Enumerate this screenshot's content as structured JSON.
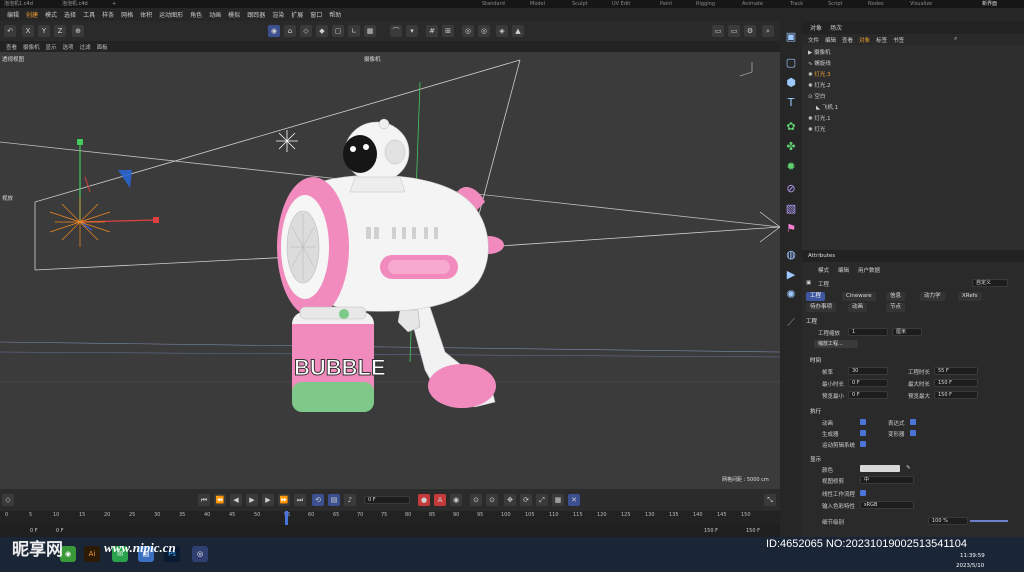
{
  "titlebar": {
    "tabs": [
      "Standard",
      "Model",
      "Sculpt",
      "UV Edit",
      "Paint",
      "Rigging",
      "Animate",
      "Track",
      "Script",
      "Nodes",
      "Visualize"
    ],
    "left_tabs": [
      "泡泡机1.c4d",
      "泡泡机.c4d",
      "+"
    ],
    "new_layout": "新界面"
  },
  "menubar": {
    "items": [
      "编辑",
      "创建",
      "模式",
      "选择",
      "工具",
      "样条",
      "网格",
      "体积",
      "运动图形",
      "角色",
      "动画",
      "模拟",
      "跟踪器",
      "渲染",
      "扩展",
      "窗口",
      "帮助"
    ],
    "active_index": 1
  },
  "toolbar": {
    "axis_labels": [
      "X",
      "Y",
      "Z"
    ]
  },
  "viewport_menu": {
    "items": [
      "查看",
      "摄像机",
      "显示",
      "选项",
      "过滤",
      "面板"
    ]
  },
  "viewport": {
    "label": "透视视图",
    "camera": "摄像机",
    "grid_info": "网格间距 : 5000 cm",
    "side_label": "视放",
    "jar_text": "BUBBLE"
  },
  "timeline": {
    "frame_current": "0 F",
    "ticks": [
      "0",
      "5",
      "10",
      "15",
      "20",
      "25",
      "30",
      "35",
      "40",
      "45",
      "50",
      "55",
      "60",
      "65",
      "70",
      "75",
      "80",
      "85",
      "90",
      "95",
      "100",
      "105",
      "110",
      "115",
      "120",
      "125",
      "130",
      "135",
      "140",
      "145",
      "150"
    ],
    "range_start": "0 F",
    "range_start2": "0 F",
    "range_end": "150 F",
    "range_end2": "150 F"
  },
  "objects_panel": {
    "tabs": [
      "对象",
      "场次"
    ],
    "menu": [
      "文件",
      "编辑",
      "查看",
      "对象",
      "标签",
      "书签"
    ],
    "items": [
      {
        "name": "摄像机",
        "color": "#dddddd"
      },
      {
        "name": "螺旋线",
        "color": "#dddddd"
      },
      {
        "name": "灯光.3",
        "color": "#f0a030"
      },
      {
        "name": "灯光.2",
        "color": "#dddddd"
      },
      {
        "name": "空白",
        "color": "#dddddd"
      },
      {
        "name": "飞机.1",
        "color": "#dddddd"
      },
      {
        "name": "灯光.1",
        "color": "#dddddd"
      },
      {
        "name": "灯光",
        "color": "#dddddd"
      }
    ]
  },
  "attributes": {
    "title": "Attributes",
    "menu": [
      "模式",
      "编辑",
      "用户数据"
    ],
    "object": "工程",
    "preset": "自定义",
    "tabs_row1": [
      "工程",
      "Cineware",
      "信息",
      "动力学",
      "XRefs"
    ],
    "tabs_row2": [
      "待办事项",
      "动画",
      "节点"
    ],
    "section_project": "工程",
    "scale_label": "工程缩放",
    "scale_value": "1",
    "scale_unit": "厘米",
    "scale_button": "缩放工程...",
    "section_time": "时间",
    "fps_label": "帧率",
    "fps_value": "30",
    "duration_label": "工程时长",
    "duration_value": "55 F",
    "min_time_label": "最小时长",
    "min_time_value": "0 F",
    "max_time_label": "最大时长",
    "max_time_value": "150 F",
    "preview_min_label": "预览最小",
    "preview_min_value": "0 F",
    "preview_max_label": "预览最大",
    "preview_max_value": "150 F",
    "section_exec": "执行",
    "exec_items": [
      "动画",
      "生成器",
      "运动剪辑系统",
      "表达式",
      "变形器"
    ],
    "section_display": "显示",
    "color_label": "颜色",
    "clip_label": "视图修剪",
    "clip_value": "中",
    "linear_label": "线性工作流程",
    "input_color_label": "输入色彩特性",
    "input_color_value": "sRGB",
    "lod_label": "细节级别",
    "lod_value": "100 %"
  },
  "taskbar": {
    "apps": [
      "Ai",
      "Ps"
    ],
    "time": "11:39:59",
    "date": "2023/5/10"
  },
  "watermark": {
    "brand": "昵享网",
    "url": "www.nipic.cn",
    "id_line": "ID:4652065 NO:20231019002513541104"
  },
  "colors": {
    "accent_blue": "#3f57a0",
    "highlight_orange": "#f0a030",
    "model_pink": "#f18bbd",
    "model_white": "#f3f3f3",
    "jar_green": "#7ec98a"
  }
}
